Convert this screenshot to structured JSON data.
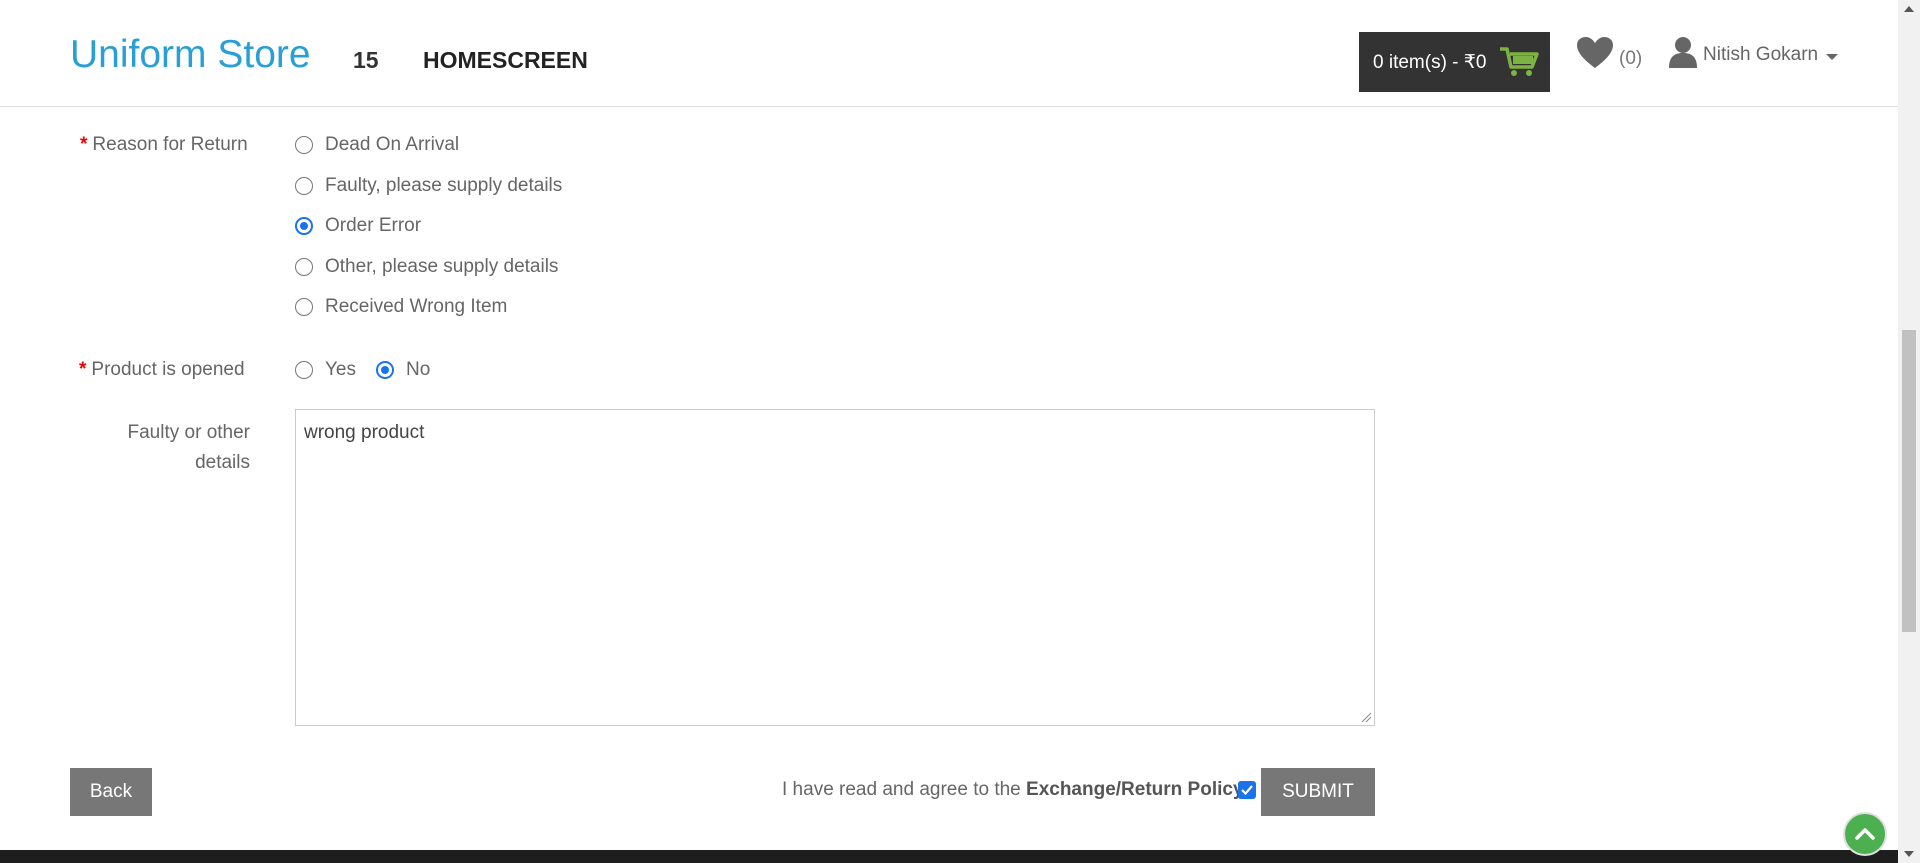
{
  "header": {
    "brand": "Uniform Store",
    "store_number": "15",
    "home_link": "HOMESCREEN",
    "cart_text": "0 item(s) - ₹0",
    "wishlist_count": "(0)",
    "user_name": "Nitish Gokarn"
  },
  "form": {
    "reason_label": "Reason for Return",
    "reasons": [
      {
        "label": "Dead On Arrival",
        "checked": false
      },
      {
        "label": "Faulty, please supply details",
        "checked": false
      },
      {
        "label": "Order Error",
        "checked": true
      },
      {
        "label": "Other, please supply details",
        "checked": false
      },
      {
        "label": "Received Wrong Item",
        "checked": false
      }
    ],
    "opened_label": "Product is opened",
    "opened_options": [
      {
        "label": "Yes",
        "checked": false
      },
      {
        "label": "No",
        "checked": true
      }
    ],
    "details_label_line1": "Faulty or other",
    "details_label_line2": "details",
    "details_value": "wrong product",
    "required_mark": "*"
  },
  "actions": {
    "back_label": "Back",
    "agree_text": "I have read and agree to the",
    "policy_link": "Exchange/Return Policy",
    "agree_checked": true,
    "submit_label": "SUBMIT"
  },
  "colors": {
    "brand": "#2a9fd6",
    "cart_bg": "#333333",
    "cart_icon": "#7cb342",
    "button_bg": "#777777",
    "radio_checked": "#1a73e8",
    "to_top": "#4caf50"
  }
}
